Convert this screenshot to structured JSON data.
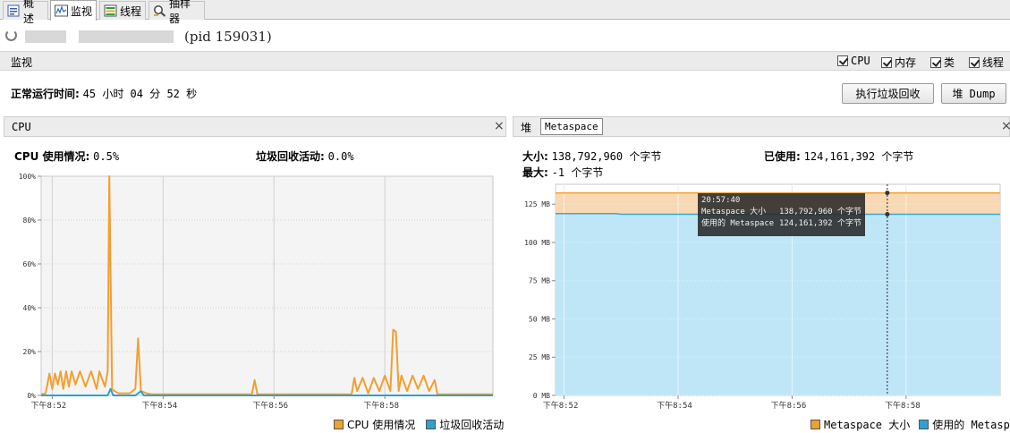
{
  "tabs": [
    {
      "label": "概述",
      "icon": "overview-icon"
    },
    {
      "label": "监视",
      "icon": "monitor-icon"
    },
    {
      "label": "线程",
      "icon": "threads-icon"
    },
    {
      "label": "抽样器",
      "icon": "sampler-icon"
    }
  ],
  "process": {
    "pid_text": "(pid 159031)"
  },
  "header": {
    "title": "监视",
    "checkboxes": [
      {
        "label": "CPU",
        "checked": true
      },
      {
        "label": "内存",
        "checked": true
      },
      {
        "label": "类",
        "checked": true
      },
      {
        "label": "线程",
        "checked": true
      }
    ]
  },
  "uptime": {
    "label": "正常运行时间:",
    "value": "45 小时 04 分 52 秒"
  },
  "buttons": {
    "gc": "执行垃圾回收",
    "heap_dump": "堆 Dump"
  },
  "cpu_panel": {
    "title": "CPU",
    "close": "×",
    "usage_label": "CPU 使用情况:",
    "usage_value": "0.5%",
    "gc_label": "垃圾回收活动:",
    "gc_value": "0.0%"
  },
  "mem_panel": {
    "tab_heap": "堆",
    "tab_metaspace": "Metaspace",
    "close": "×",
    "size_label": "大小:",
    "size_value": "138,792,960 个字节",
    "max_label": "最大:",
    "max_value": "-1 个字节",
    "used_label": "已使用:",
    "used_value": "124,161,392 个字节"
  },
  "tooltip": {
    "time": "20:57:40",
    "row1_label": "Metaspace 大小",
    "row1_value": "138,792,960 个字节",
    "row2_label": "使用的 Metaspace",
    "row2_value": "124,161,392 个字节"
  },
  "chart_data": [
    {
      "type": "line",
      "ylim": [
        0,
        100
      ],
      "y_ticks": [
        0,
        20,
        40,
        60,
        80,
        100
      ],
      "y_tick_labels": [
        "0%",
        "20%",
        "40%",
        "60%",
        "80%",
        "100%"
      ],
      "x_ticks": [
        0,
        2,
        4,
        6
      ],
      "x_tick_labels": [
        "下午8:52",
        "下午8:54",
        "下午8:56",
        "下午8:58"
      ],
      "xlim": [
        -0.2,
        7.95
      ],
      "series": [
        {
          "name": "CPU 使用情况",
          "color": "#f0a030",
          "points": [
            [
              -0.2,
              0.5
            ],
            [
              -0.12,
              1
            ],
            [
              -0.05,
              10
            ],
            [
              0,
              3
            ],
            [
              0.05,
              10
            ],
            [
              0.1,
              5
            ],
            [
              0.15,
              11
            ],
            [
              0.2,
              3
            ],
            [
              0.25,
              11
            ],
            [
              0.3,
              4
            ],
            [
              0.35,
              11
            ],
            [
              0.42,
              5
            ],
            [
              0.5,
              11
            ],
            [
              0.6,
              4
            ],
            [
              0.7,
              11
            ],
            [
              0.8,
              3
            ],
            [
              0.85,
              11
            ],
            [
              0.95,
              4
            ],
            [
              1.0,
              11
            ],
            [
              1.03,
              100
            ],
            [
              1.08,
              3
            ],
            [
              1.12,
              2
            ],
            [
              1.2,
              1
            ],
            [
              1.4,
              1
            ],
            [
              1.5,
              3
            ],
            [
              1.55,
              26
            ],
            [
              1.6,
              2
            ],
            [
              1.7,
              1
            ],
            [
              1.8,
              0.5
            ],
            [
              3.6,
              0.5
            ],
            [
              3.65,
              7
            ],
            [
              3.7,
              0.5
            ],
            [
              5.4,
              0.5
            ],
            [
              5.45,
              8
            ],
            [
              5.5,
              2
            ],
            [
              5.6,
              8
            ],
            [
              5.7,
              1
            ],
            [
              5.8,
              8
            ],
            [
              5.9,
              2
            ],
            [
              6.0,
              9
            ],
            [
              6.1,
              2
            ],
            [
              6.15,
              30
            ],
            [
              6.2,
              29
            ],
            [
              6.25,
              2
            ],
            [
              6.3,
              9
            ],
            [
              6.4,
              2
            ],
            [
              6.5,
              9
            ],
            [
              6.6,
              3
            ],
            [
              6.7,
              9
            ],
            [
              6.8,
              2
            ],
            [
              6.9,
              7
            ],
            [
              6.95,
              0.5
            ],
            [
              7.95,
              0.5
            ]
          ]
        },
        {
          "name": "垃圾回收活动",
          "color": "#30a0d0",
          "points": [
            [
              -0.2,
              0
            ],
            [
              1.0,
              0
            ],
            [
              1.05,
              3
            ],
            [
              1.1,
              0
            ],
            [
              1.5,
              0
            ],
            [
              1.6,
              2
            ],
            [
              1.65,
              0
            ],
            [
              7.95,
              0
            ]
          ]
        }
      ]
    },
    {
      "type": "area",
      "ylim": [
        0,
        138
      ],
      "y_ticks": [
        0,
        25,
        50,
        75,
        100,
        125
      ],
      "y_tick_labels": [
        "0 MB",
        "25 MB",
        "50 MB",
        "75 MB",
        "100 MB",
        "125 MB"
      ],
      "x_ticks": [
        0,
        2,
        4,
        6
      ],
      "x_tick_labels": [
        "下午8:52",
        "下午8:54",
        "下午8:56",
        "下午8:58"
      ],
      "xlim": [
        -0.15,
        7.65
      ],
      "marker_x": 5.67,
      "series": [
        {
          "name": "Metaspace 大小",
          "color": "#f0a030",
          "fill": "#f8d9b4",
          "points": [
            [
              -0.15,
              132.4
            ],
            [
              7.65,
              132.4
            ]
          ]
        },
        {
          "name": "使用的 Metaspace",
          "color": "#3aa8d0",
          "fill": "#bfe6f7",
          "points": [
            [
              -0.15,
              118.9
            ],
            [
              0.9,
              118.9
            ],
            [
              1.0,
              118.4
            ],
            [
              7.65,
              118.4
            ]
          ]
        }
      ]
    }
  ]
}
